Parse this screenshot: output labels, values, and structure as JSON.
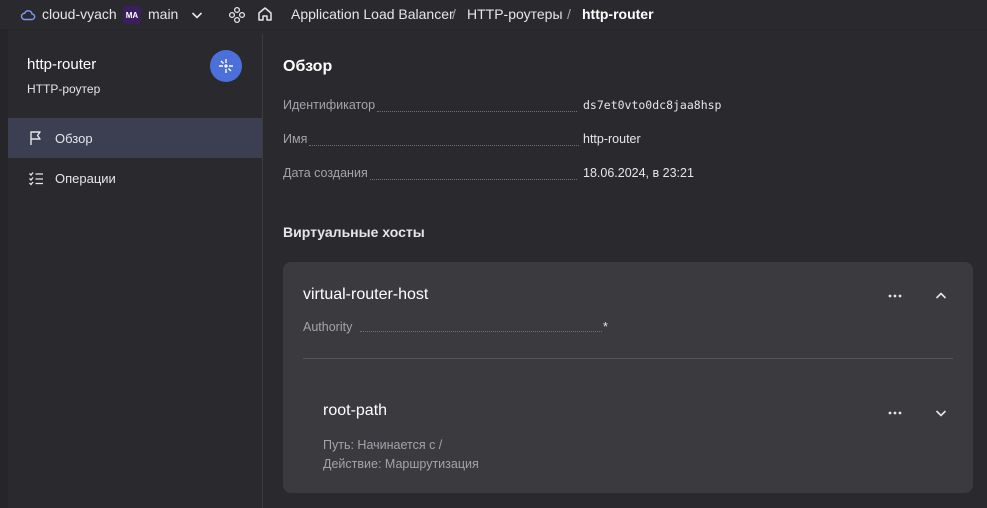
{
  "topbar": {
    "cloud_name": "cloud-vyach",
    "folder_badge": "MA",
    "folder_name": "main",
    "breadcrumbs": [
      "Application Load Balancer",
      "HTTP-роутеры",
      "http-router"
    ],
    "separator": "/"
  },
  "sidebar": {
    "title": "http-router",
    "subtitle": "HTTP-роутер",
    "items": [
      {
        "label": "Обзор",
        "icon": "flag-icon",
        "active": true
      },
      {
        "label": "Операции",
        "icon": "list-check-icon",
        "active": false
      }
    ]
  },
  "main": {
    "section_title": "Обзор",
    "fields": [
      {
        "key": "Идентификатор",
        "value": "ds7et0vto0dc8jaa8hsp"
      },
      {
        "key": "Имя",
        "value": "http-router"
      },
      {
        "key": "Дата создания",
        "value": "18.06.2024, в 23:21"
      }
    ],
    "virtual_hosts_title": "Виртуальные хосты",
    "host": {
      "name": "virtual-router-host",
      "authority_key": "Authority",
      "authority_value": "*",
      "route": {
        "name": "root-path",
        "path_line": "Путь: Начинается с /",
        "action_line": "Действие: Маршрутизация"
      }
    }
  },
  "colors": {
    "background": "#2a2a2e",
    "card": "#3a3a3f",
    "active_nav": "#3c3f52",
    "accent": "#4b70d9",
    "cloud_icon": "#7b9cf4"
  }
}
